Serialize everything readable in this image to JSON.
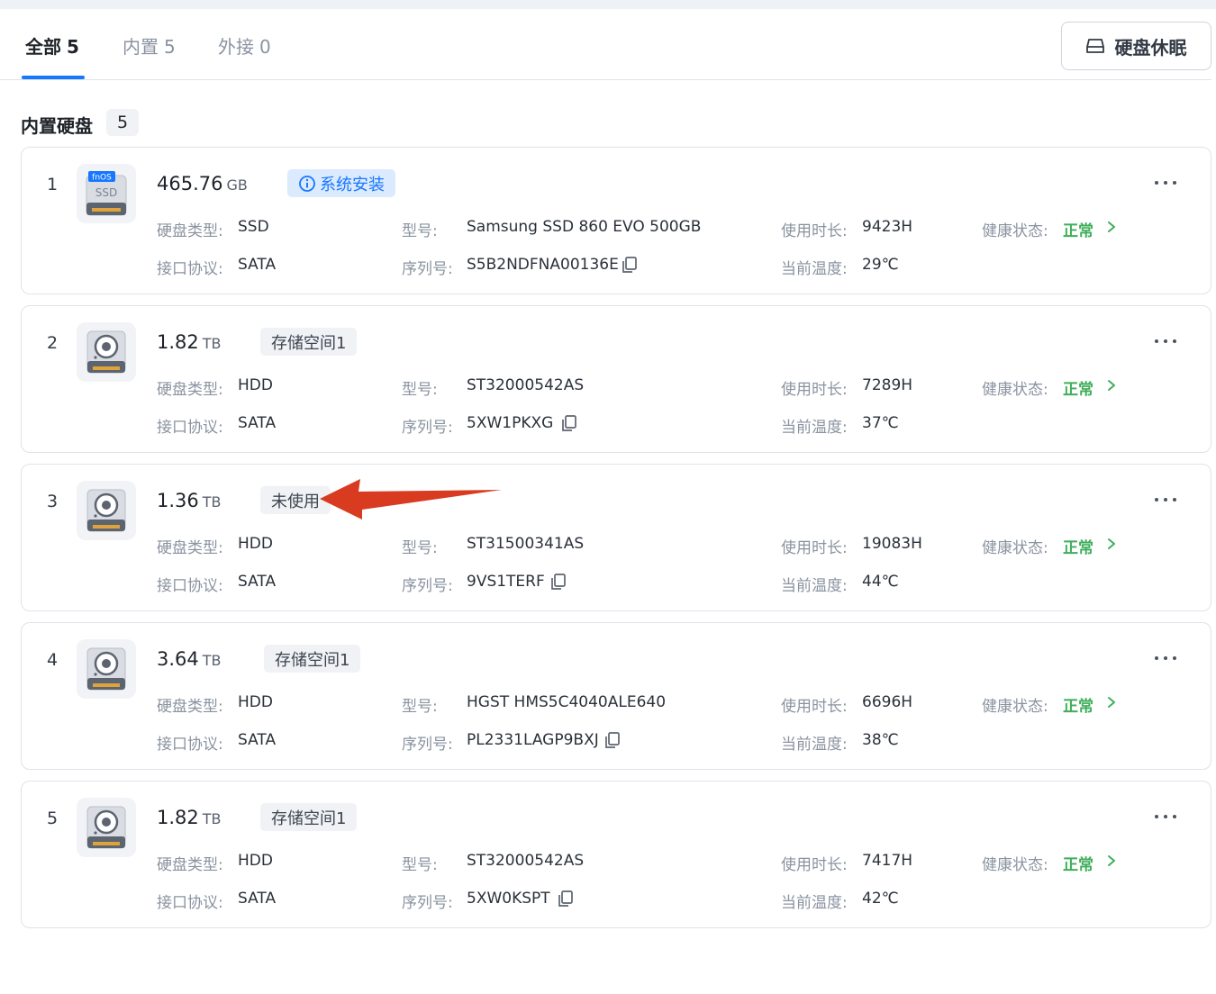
{
  "tabs": [
    {
      "label": "全部",
      "count": "5"
    },
    {
      "label": "内置",
      "count": "5"
    },
    {
      "label": "外接",
      "count": "0"
    }
  ],
  "sleep_button": "硬盘休眠",
  "section": {
    "title": "内置硬盘",
    "count": "5"
  },
  "labels": {
    "type": "硬盘类型:",
    "interface": "接口协议:",
    "model": "型号:",
    "serial": "序列号:",
    "hours": "使用时长:",
    "temp": "当前温度:",
    "health": "健康状态:"
  },
  "ssd_icon_text": {
    "brand": "fnOS",
    "kind": "SSD"
  },
  "disks": [
    {
      "index": "1",
      "icon": "ssd-icon",
      "size": "465.76",
      "unit": "GB",
      "tag": "系统安装",
      "tag_kind": "system",
      "type": "SSD",
      "interface": "SATA",
      "model": "Samsung SSD 860 EVO 500GB",
      "serial": "S5B2NDFNA00136E",
      "hours": "9423H",
      "temp": "29℃",
      "health": "正常"
    },
    {
      "index": "2",
      "icon": "hdd-icon",
      "size": "1.82",
      "unit": "TB",
      "tag": "存储空间1",
      "tag_kind": "plain",
      "type": "HDD",
      "interface": "SATA",
      "model": "ST32000542AS",
      "serial": "5XW1PKXG",
      "hours": "7289H",
      "temp": "37℃",
      "health": "正常"
    },
    {
      "index": "3",
      "icon": "hdd-icon",
      "size": "1.36",
      "unit": "TB",
      "tag": "未使用",
      "tag_kind": "plain",
      "type": "HDD",
      "interface": "SATA",
      "model": "ST31500341AS",
      "serial": "9VS1TERF",
      "hours": "19083H",
      "temp": "44℃",
      "health": "正常"
    },
    {
      "index": "4",
      "icon": "hdd-icon",
      "size": "3.64",
      "unit": "TB",
      "tag": "存储空间1",
      "tag_kind": "plain",
      "type": "HDD",
      "interface": "SATA",
      "model": "HGST HMS5C4040ALE640",
      "serial": "PL2331LAGP9BXJ",
      "hours": "6696H",
      "temp": "38℃",
      "health": "正常"
    },
    {
      "index": "5",
      "icon": "hdd-icon",
      "size": "1.82",
      "unit": "TB",
      "tag": "存储空间1",
      "tag_kind": "plain",
      "type": "HDD",
      "interface": "SATA",
      "model": "ST32000542AS",
      "serial": "5XW0KSPT",
      "hours": "7417H",
      "temp": "42℃",
      "health": "正常"
    }
  ],
  "colors": {
    "accent": "#1677ff",
    "health_ok": "#3fae5a",
    "annotation_arrow": "#d83b1f"
  }
}
